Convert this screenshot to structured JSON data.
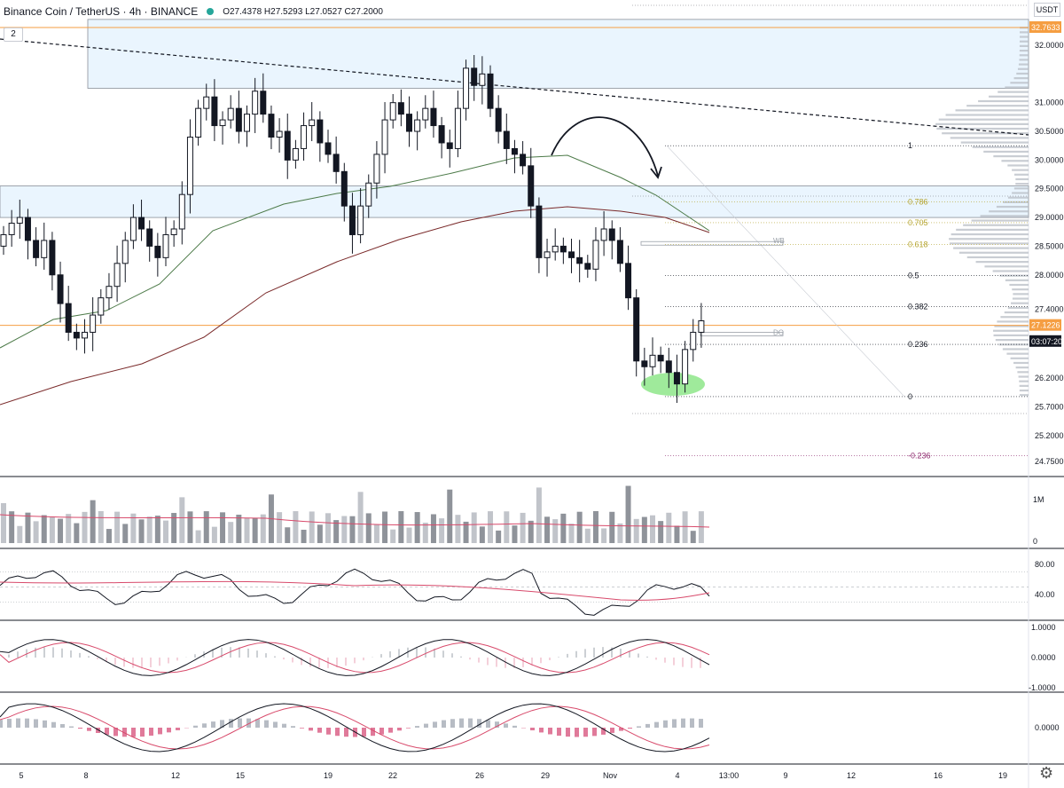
{
  "header": {
    "symbol": "Binance Coin / TetherUS · 4h · BINANCE",
    "ohlc": "O27.4378 H27.5293 L27.0527 C27.2000",
    "indicator_count": "2",
    "currency_label": "USDT"
  },
  "price_axis": {
    "labels": [
      "32.0000",
      "31.0000",
      "30.5000",
      "30.0000",
      "29.5000",
      "29.0000",
      "28.5000",
      "28.0000",
      "27.4000",
      "26.2000",
      "25.7000",
      "25.2000",
      "24.7500"
    ],
    "markers": [
      {
        "text": "32.7633",
        "color": "#f59e42"
      },
      {
        "text": "27.1226",
        "color": "#f59e42"
      },
      {
        "text": "03:07:20",
        "color": "#131722"
      }
    ]
  },
  "fib_levels": [
    {
      "label": "1",
      "price": 30.25,
      "color": "#131722"
    },
    {
      "label": "0.786",
      "price": 29.27,
      "color": "#b5a42e"
    },
    {
      "label": "0.705",
      "price": 28.91,
      "color": "#b5a42e"
    },
    {
      "label": "0.618",
      "price": 28.53,
      "color": "#b5a42e"
    },
    {
      "label": "0.5",
      "price": 27.99,
      "color": "#131722"
    },
    {
      "label": "0.382",
      "price": 27.45,
      "color": "#131722"
    },
    {
      "label": "0.236",
      "price": 26.79,
      "color": "#131722"
    },
    {
      "label": "0",
      "price": 25.88,
      "color": "#131722"
    },
    {
      "label": "-0.236",
      "price": 24.85,
      "color": "#8e2a6e"
    }
  ],
  "annotations": {
    "wb": "WB",
    "do": "DO"
  },
  "volume_axis": [
    "1M",
    "0"
  ],
  "rsi_axis": [
    "80.00",
    "40.00"
  ],
  "macd_axis": [
    "1.0000",
    "0.0000",
    "-1.0000"
  ],
  "stoch_axis": [
    "0.0000"
  ],
  "time_axis": [
    "5",
    "8",
    "12",
    "15",
    "19",
    "22",
    "26",
    "29",
    "Nov",
    "4",
    "13:00",
    "9",
    "12",
    "16",
    "19"
  ],
  "colors": {
    "orange_line": "#f59e42",
    "zone_fill": "#e3f2fd",
    "ma_green": "#4c7a48",
    "ma_red": "#7a2a2a",
    "ellipse": "#8ee68a"
  },
  "chart_data": {
    "type": "candlestick",
    "symbol": "BNB/USDT",
    "timeframe": "4h",
    "ylim": [
      24.6,
      32.9
    ],
    "last": {
      "open": 27.4378,
      "high": 27.5293,
      "low": 27.0527,
      "close": 27.2
    },
    "closes": [
      28.7,
      28.9,
      29.0,
      28.6,
      28.3,
      28.6,
      28.0,
      27.5,
      27.0,
      26.9,
      27.0,
      27.3,
      27.6,
      27.8,
      28.2,
      28.6,
      29.0,
      28.8,
      28.5,
      28.3,
      28.7,
      28.8,
      29.4,
      30.4,
      30.9,
      31.1,
      30.6,
      30.7,
      30.9,
      30.5,
      30.8,
      31.2,
      30.8,
      30.4,
      30.5,
      30.0,
      30.2,
      30.6,
      30.7,
      30.3,
      30.1,
      29.8,
      29.2,
      28.7,
      29.2,
      29.6,
      30.1,
      30.7,
      31.0,
      30.8,
      30.5,
      30.7,
      30.9,
      30.6,
      30.3,
      30.2,
      30.9,
      31.6,
      31.3,
      31.5,
      30.9,
      30.5,
      30.2,
      30.1,
      29.9,
      29.2,
      28.3,
      28.4,
      28.5,
      28.4,
      28.3,
      28.2,
      28.1,
      28.6,
      28.8,
      28.6,
      28.2,
      27.6,
      26.5,
      26.4,
      26.6,
      26.5,
      26.3,
      26.1,
      26.7,
      27.0,
      27.2
    ]
  }
}
